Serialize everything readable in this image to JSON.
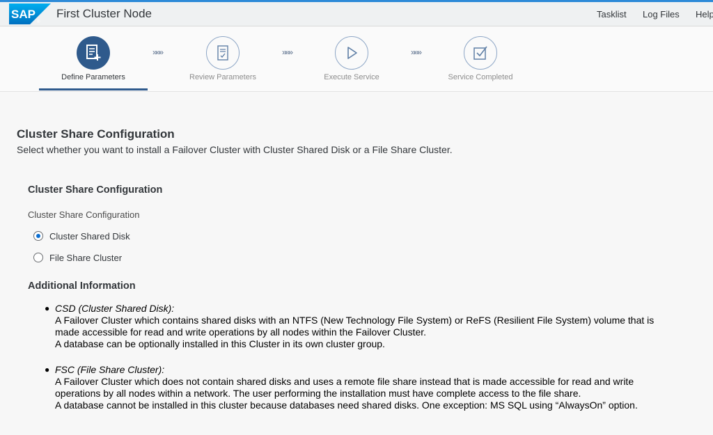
{
  "header": {
    "logo_text": "SAP",
    "title": "First Cluster Node",
    "links": [
      "Tasklist",
      "Log Files",
      "Help"
    ]
  },
  "stepper": {
    "steps": [
      {
        "label": "Define Parameters",
        "icon": "edit-document-icon",
        "active": true
      },
      {
        "label": "Review Parameters",
        "icon": "document-check-icon",
        "active": false
      },
      {
        "label": "Execute Service",
        "icon": "play-icon",
        "active": false
      },
      {
        "label": "Service Completed",
        "icon": "checkbox-icon",
        "active": false
      }
    ],
    "separator": "»»»"
  },
  "main": {
    "title": "Cluster Share Configuration",
    "description": "Select whether you want to install a Failover Cluster with Cluster Shared Disk or a File Share Cluster.",
    "section_title": "Cluster Share Configuration",
    "field_label": "Cluster Share Configuration",
    "options": [
      {
        "label": "Cluster Shared Disk",
        "selected": true
      },
      {
        "label": "File Share Cluster",
        "selected": false
      }
    ],
    "info_title": "Additional Information",
    "info_items": [
      {
        "heading": "CSD (Cluster Shared Disk):",
        "lines": [
          "A Failover Cluster which contains shared disks with an NTFS (New Technology File System) or ReFS (Resilient File System) volume that is",
          "made accessible for read and write operations by all nodes within the Failover Cluster.",
          "A database can be optionally installed in this Cluster in its own cluster group."
        ]
      },
      {
        "heading": "FSC (File Share Cluster):",
        "lines": [
          "A Failover Cluster which does not contain shared disks and uses a remote file share instead that is made accessible for read and write",
          "operations by all nodes within a network. The user performing the installation must have complete access to the file share.",
          "A database cannot be installed in this cluster because databases need shared disks. One exception: MS SQL using “AlwaysOn” option."
        ]
      }
    ]
  },
  "colors": {
    "accent": "#2f5a8c",
    "top_border": "#2d8ad8",
    "radio_selected": "#0a6ed1"
  }
}
